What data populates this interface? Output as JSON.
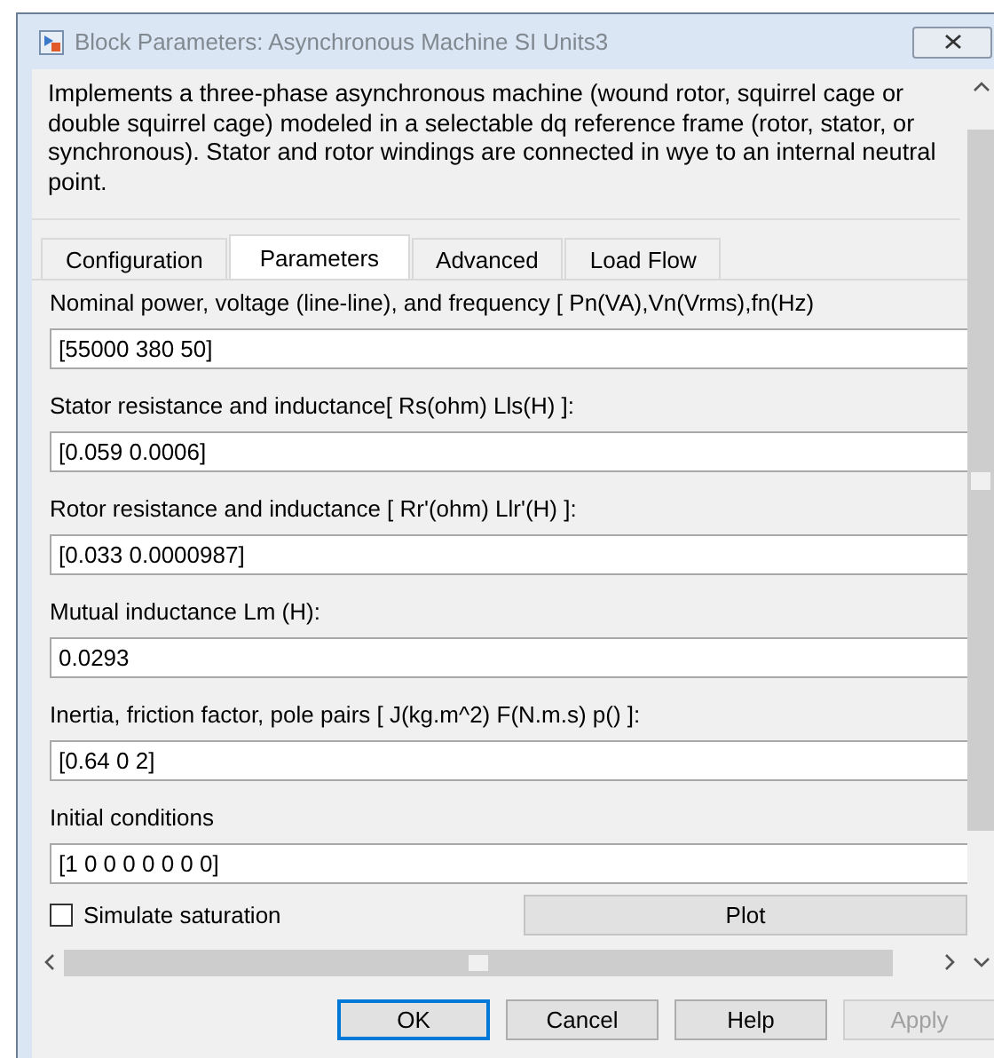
{
  "window": {
    "title": "Block Parameters: Asynchronous Machine SI Units3"
  },
  "description": "Implements a three-phase asynchronous machine (wound rotor, squirrel cage or double squirrel cage) modeled in a selectable dq reference frame (rotor, stator, or synchronous). Stator and rotor windings are connected in wye to an internal neutral point.",
  "tabs": [
    {
      "label": "Configuration",
      "selected": false
    },
    {
      "label": "Parameters",
      "selected": true
    },
    {
      "label": "Advanced",
      "selected": false
    },
    {
      "label": "Load Flow",
      "selected": false
    }
  ],
  "parameters": [
    {
      "label": "Nominal power, voltage (line-line), and frequency [ Pn(VA),Vn(Vrms),fn(Hz)",
      "value": "[55000 380 50]"
    },
    {
      "label": "Stator resistance and inductance[ Rs(ohm)  Lls(H) ]:",
      "value": "[0.059 0.0006]"
    },
    {
      "label": "Rotor resistance and inductance [ Rr'(ohm)  Llr'(H) ]:",
      "value": "[0.033 0.0000987]"
    },
    {
      "label": "Mutual inductance Lm (H):",
      "value": "0.0293"
    },
    {
      "label": "Inertia, friction factor, pole pairs [ J(kg.m^2)  F(N.m.s)   p() ]:",
      "value": "[0.64 0 2]"
    },
    {
      "label": "Initial conditions",
      "value": "[1 0 0 0 0 0 0 0]"
    }
  ],
  "saturation": {
    "label": "Simulate saturation",
    "checked": false
  },
  "plot_button": "Plot",
  "buttons": [
    {
      "label": "OK",
      "focused": true,
      "disabled": false
    },
    {
      "label": "Cancel",
      "focused": false,
      "disabled": false
    },
    {
      "label": "Help",
      "focused": false,
      "disabled": false
    },
    {
      "label": "Apply",
      "focused": false,
      "disabled": true
    }
  ]
}
